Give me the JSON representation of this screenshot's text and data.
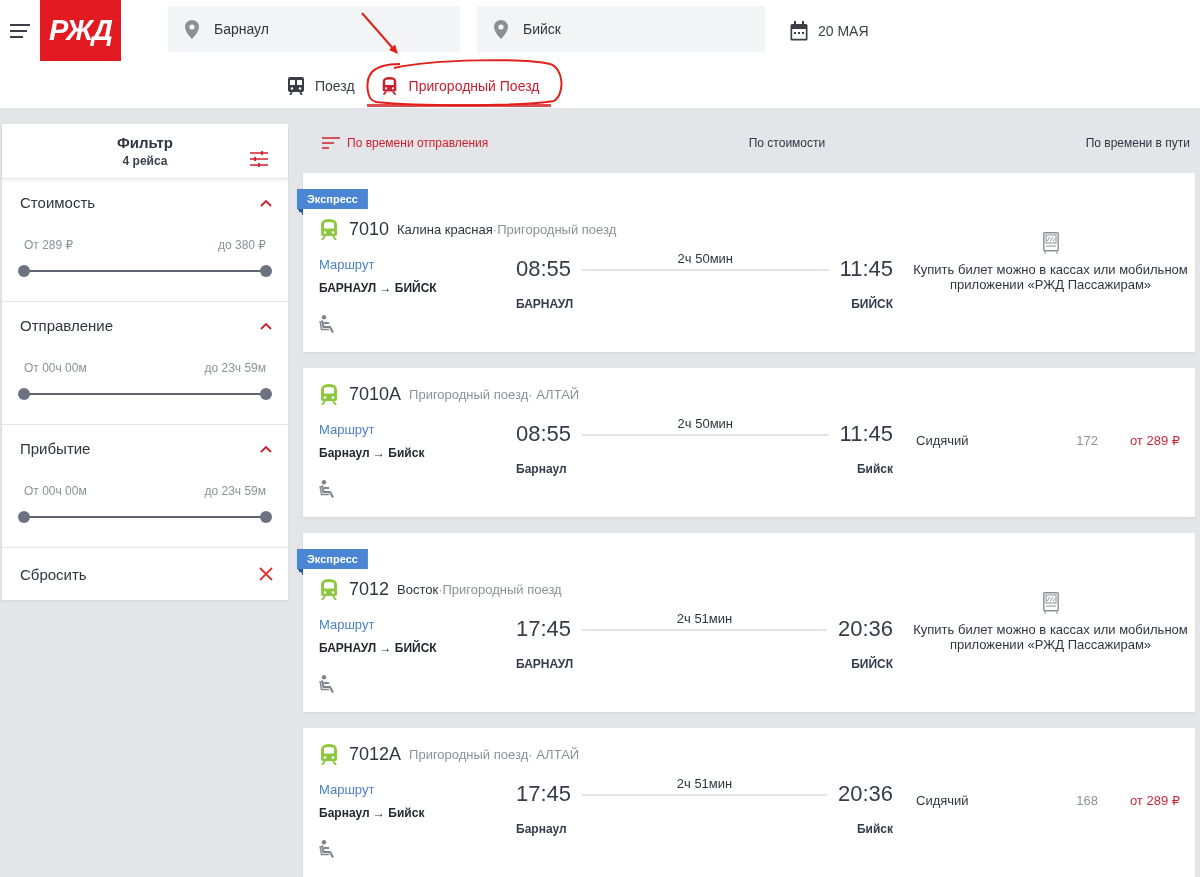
{
  "header": {
    "logo": "РЖД",
    "from": "Барнаул",
    "to": "Бийск",
    "date": "20 МАЯ"
  },
  "tabs": [
    {
      "label": "Поезд",
      "kind": "train",
      "selected": false
    },
    {
      "label": "Пригородный Поезд",
      "kind": "suburban",
      "selected": true
    }
  ],
  "filter": {
    "title": "Фильтр",
    "subtitle": "4 рейса",
    "sections": [
      {
        "title": "Стоимость",
        "expanded": true,
        "from": "От 289 ₽",
        "to": "до 380 ₽",
        "level": 1
      },
      {
        "title": "Отправление",
        "expanded": true,
        "from": "От 00ч 00м",
        "to": "до 23ч 59м",
        "level": 1
      },
      {
        "title": "Прибытие",
        "expanded": true,
        "from": "От 00ч 00м",
        "to": "до 23ч 59м",
        "level": 1
      }
    ],
    "reset": "Сбросить"
  },
  "sort": [
    {
      "label": "По времени отправления",
      "selected": true
    },
    {
      "label": "По стоимости",
      "selected": false
    },
    {
      "label": "По времени в пути",
      "selected": false
    }
  ],
  "trains": [
    {
      "kind": "notice",
      "badge": "Экспресс",
      "number": "7010",
      "name": "Калина красная",
      "category": "·Пригородный поезд",
      "route_link": "Маршрут",
      "route": "БАРНАУЛ → БИЙСК",
      "departure": "08:55",
      "duration": "2ч 50мин",
      "arrival": "11:45",
      "from_station": "БАРНАУЛ",
      "to_station": "БИЙСК",
      "notice": "Купить билет можно в кассах или мобильном приложении «РЖД Пассажирам»"
    },
    {
      "kind": "fare",
      "number": "7010А",
      "category": "Пригородный поезд· АЛТАЙ",
      "route_link": "Маршрут",
      "route": "Барнаул → Бийск",
      "departure": "08:55",
      "duration": "2ч 50мин",
      "arrival": "11:45",
      "from_station": "Барнаул",
      "to_station": "Бийск",
      "fare": {
        "car_class": "Сидячий",
        "seats": "172",
        "price": "от 289 ₽"
      }
    },
    {
      "kind": "notice",
      "badge": "Экспресс",
      "number": "7012",
      "name": "Восток",
      "category": "·Пригородный поезд",
      "route_link": "Маршрут",
      "route": "БАРНАУЛ → БИЙСК",
      "departure": "17:45",
      "duration": "2ч 51мин",
      "arrival": "20:36",
      "from_station": "БАРНАУЛ",
      "to_station": "БИЙСК",
      "notice": "Купить билет можно в кассах или мобильном приложении «РЖД Пассажирам»"
    },
    {
      "kind": "fare",
      "number": "7012А",
      "category": "Пригородный поезд· АЛТАЙ",
      "route_link": "Маршрут",
      "route": "Барнаул → Бийск",
      "departure": "17:45",
      "duration": "2ч 51мин",
      "arrival": "20:36",
      "from_station": "Барнаул",
      "to_station": "Бийск",
      "fare": {
        "car_class": "Сидячий",
        "seats": "168",
        "price": "от 289 ₽"
      }
    }
  ]
}
